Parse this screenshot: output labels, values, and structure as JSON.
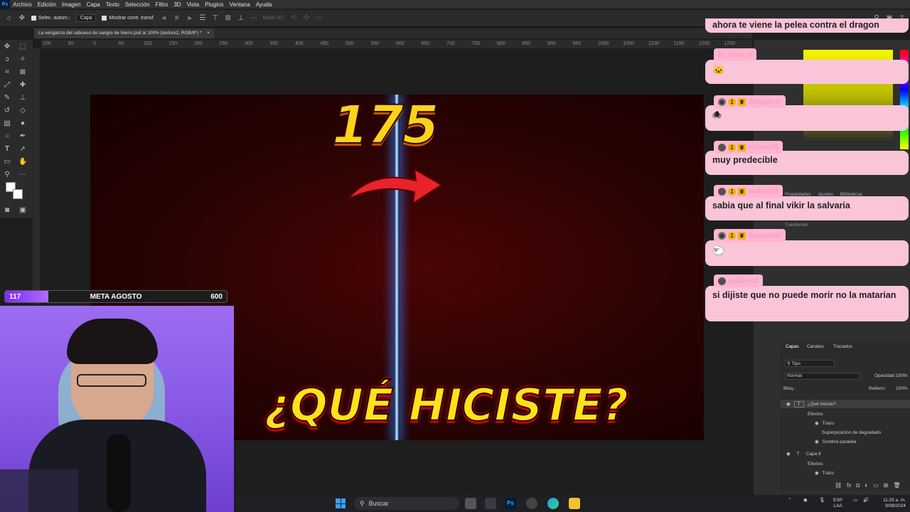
{
  "app": {
    "menu": [
      "Archivo",
      "Edición",
      "Imagen",
      "Capa",
      "Texto",
      "Selección",
      "Filtro",
      "3D",
      "Vista",
      "Plugins",
      "Ventana",
      "Ayuda"
    ],
    "ps_logo": "Ps"
  },
  "options": {
    "auto_select": "Selec. autom.:",
    "layer_select": "Capa",
    "show_transform": "Mostrar contr. transf.",
    "mode_3d": "Modo 3D:"
  },
  "document": {
    "tab_title": "La venganza del sabueso de sangre de hierro.psd al 100% (texture2, RGB/8*) *"
  },
  "ruler": [
    "100",
    "50",
    "0",
    "50",
    "100",
    "150",
    "200",
    "250",
    "300",
    "350",
    "400",
    "450",
    "500",
    "550",
    "600",
    "650",
    "700",
    "750",
    "800",
    "850",
    "900",
    "950",
    "1000",
    "1050",
    "1100",
    "1150",
    "1200",
    "1250"
  ],
  "canvas": {
    "number": "175",
    "headline": "¿QUÉ HICISTE?"
  },
  "goal": {
    "current": "117",
    "label": "META AGOSTO",
    "target": "600",
    "progress": 0.195
  },
  "chat": {
    "top_partial": "ahora te viene la pelea contra el dragon",
    "messages": [
      {
        "user": "la_tribu_d",
        "text": ""
      },
      {
        "user": "dragaoxel",
        "text": ""
      },
      {
        "user": "nellme08",
        "text": "muy predecible"
      },
      {
        "user": "nellme08",
        "text": "sabia que al final vikir la salvaria"
      },
      {
        "user": "dragaoxel",
        "text": ""
      },
      {
        "user": "nellme08",
        "text": "si dijiste que no puede morir no la matarian"
      }
    ]
  },
  "panels": {
    "tabs_props": [
      "Propiedades",
      "Ajustes",
      "Bibliotecas"
    ],
    "transform_label": "Transformar",
    "layers_tabs": [
      "Capas",
      "Canales",
      "Trazados"
    ],
    "filter_kind": "Tipo",
    "blend_mode": "Normal",
    "opacity_label": "Opacidad:",
    "opacity_value": "100%",
    "lock_label": "Bloq.:",
    "fill_label": "Relleno:",
    "fill_value": "100%",
    "layers": [
      {
        "name": "¿Qué hiciste?",
        "type": "text"
      },
      {
        "name": "Efectos",
        "type": "fx"
      },
      {
        "name": "Trazo",
        "type": "effect"
      },
      {
        "name": "Superposición de degradado",
        "type": "effect"
      },
      {
        "name": "Sombra paralela",
        "type": "effect"
      },
      {
        "name": "Capa 8",
        "type": "text"
      },
      {
        "name": "Efectos",
        "type": "fx"
      },
      {
        "name": "Trazo",
        "type": "effect"
      }
    ]
  },
  "taskbar": {
    "search_placeholder": "Buscar",
    "lang": "ESP",
    "lang_sub": "LAA",
    "time": "11:25 a. m.",
    "date": "9/08/2024"
  },
  "colors": {
    "chat_bubble": "#fac4d9",
    "goal_fill": "#7a2cff",
    "headline": "#ffe21a"
  }
}
